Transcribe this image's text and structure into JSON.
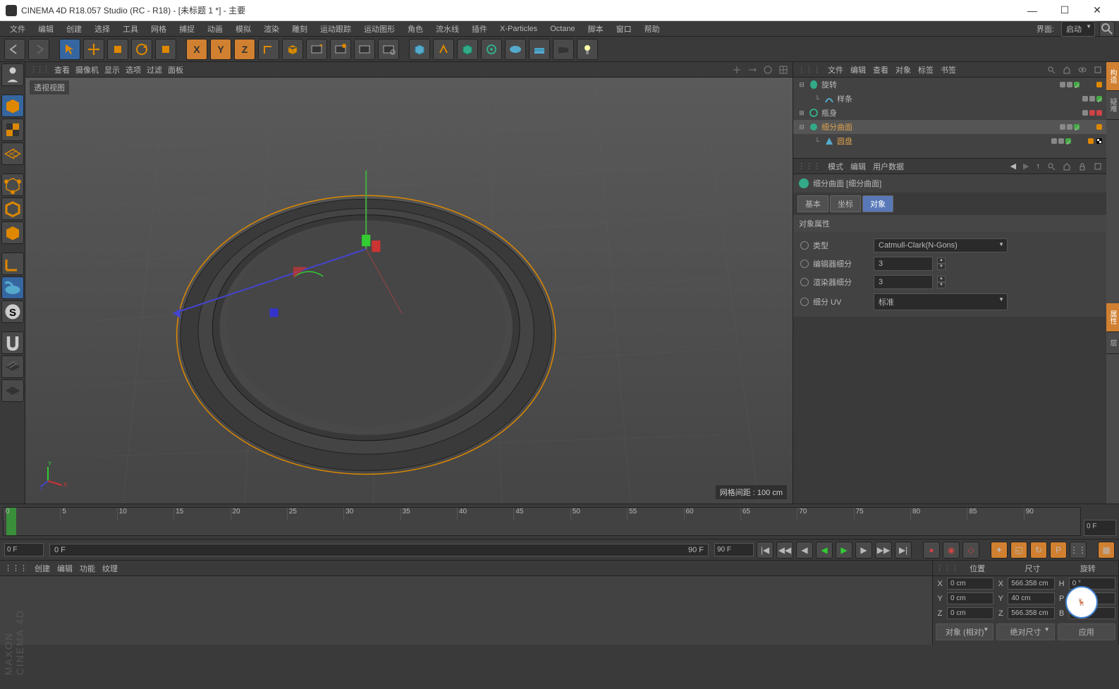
{
  "title": "CINEMA 4D R18.057 Studio (RC - R18) - [未标题 1 *] - 主要",
  "menu": {
    "items": [
      "文件",
      "编辑",
      "创建",
      "选择",
      "工具",
      "网格",
      "捕捉",
      "动画",
      "模拟",
      "渲染",
      "雕刻",
      "运动跟踪",
      "运动图形",
      "角色",
      "流水线",
      "插件",
      "X-Particles",
      "Octane",
      "脚本",
      "窗口",
      "帮助"
    ],
    "layoutLabel": "界面:",
    "layoutValue": "启动"
  },
  "viewport": {
    "tabs": [
      "查看",
      "摄像机",
      "显示",
      "选项",
      "过滤",
      "面板"
    ],
    "label": "透视视图",
    "gridInfo": "网格间距 : 100 cm"
  },
  "objpanel": {
    "menus": [
      "文件",
      "编辑",
      "查看",
      "对象",
      "标签",
      "书签"
    ]
  },
  "tree": [
    {
      "expand": "⊟",
      "icon": "lathe",
      "name": "旋转",
      "dots": [
        "gray",
        "green",
        "green"
      ],
      "tags": [
        "orange"
      ]
    },
    {
      "indent": 1,
      "expand": "└",
      "icon": "spline",
      "name": "样条",
      "dots": [
        "gray",
        "green",
        "green"
      ]
    },
    {
      "expand": "⊟",
      "icon": "null",
      "name": "瓶身",
      "dots": [
        "gray",
        "red",
        "red"
      ]
    },
    {
      "expand": "⊟",
      "icon": "sds",
      "name": "细分曲面",
      "sel": true,
      "hl": true,
      "dots": [
        "gray",
        "green",
        "green"
      ],
      "tags": [
        "orange"
      ]
    },
    {
      "indent": 1,
      "expand": "└",
      "icon": "disc",
      "name": "圆盘",
      "hl": true,
      "dots": [
        "gray",
        "green",
        "green"
      ],
      "tags": [
        "orange",
        "check"
      ]
    }
  ],
  "attr": {
    "menus": [
      "模式",
      "编辑",
      "用户数据"
    ],
    "objTitle": "细分曲面 [细分曲面]",
    "tabs": [
      "基本",
      "坐标",
      "对象"
    ],
    "activeTab": 2,
    "sectionTitle": "对象属性",
    "rows": [
      {
        "label": "类型",
        "type": "select",
        "value": "Catmull-Clark(N-Gons)"
      },
      {
        "label": "编辑器细分",
        "type": "number",
        "value": "3"
      },
      {
        "label": "渲染器细分",
        "type": "number",
        "value": "3"
      },
      {
        "label": "细分 UV",
        "type": "select",
        "value": "标准"
      }
    ]
  },
  "timeline": {
    "marks": [
      "0",
      "5",
      "10",
      "15",
      "20",
      "25",
      "30",
      "35",
      "40",
      "45",
      "50",
      "55",
      "60",
      "65",
      "70",
      "75",
      "80",
      "85",
      "90"
    ],
    "endLabel": "0 F"
  },
  "transport": {
    "start": "0 F",
    "sliderStart": "0 F",
    "sliderEnd": "90 F",
    "end": "90 F"
  },
  "matpanel": {
    "menus": [
      "创建",
      "编辑",
      "功能",
      "纹理"
    ]
  },
  "coord": {
    "headers": [
      "位置",
      "尺寸",
      "旋转"
    ],
    "rows": [
      {
        "axis": "X",
        "pos": "0 cm",
        "size": "566.358 cm",
        "rlabel": "H",
        "rot": "0 °"
      },
      {
        "axis": "Y",
        "pos": "0 cm",
        "size": "40 cm",
        "rlabel": "P",
        "rot": "0 °"
      },
      {
        "axis": "Z",
        "pos": "0 cm",
        "size": "566.358 cm",
        "rlabel": "B",
        "rot": "0 °"
      }
    ],
    "footer": [
      "对象 (相对)",
      "绝对尺寸",
      "应用"
    ]
  },
  "rtabs": [
    "构造",
    "疑难",
    "属性",
    "层"
  ]
}
